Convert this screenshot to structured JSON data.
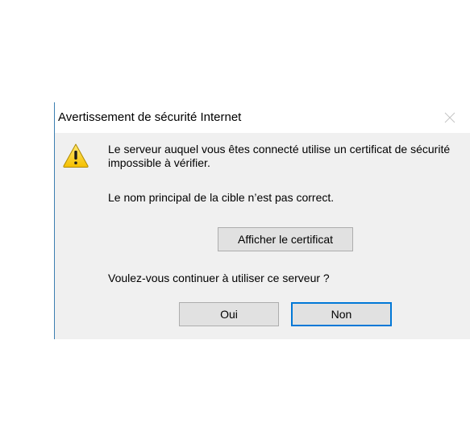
{
  "dialog": {
    "title": "Avertissement de sécurité Internet",
    "close_icon": "close-icon",
    "warning_icon": "warning-icon",
    "message_main": "Le serveur auquel vous êtes connecté utilise un certificat de sécurité impossible à vérifier.",
    "message_detail": "Le nom principal de la cible n’est pas correct.",
    "view_certificate_label": "Afficher le certificat",
    "question": "Voulez-vous continuer à utiliser ce serveur ?",
    "yes_label": "Oui",
    "no_label": "Non"
  },
  "colors": {
    "content_background": "#f0f0f0",
    "button_background": "#e1e1e1",
    "button_border": "#adadad",
    "default_button_focus": "#0078d7",
    "window_border": "#3c7fb1"
  }
}
